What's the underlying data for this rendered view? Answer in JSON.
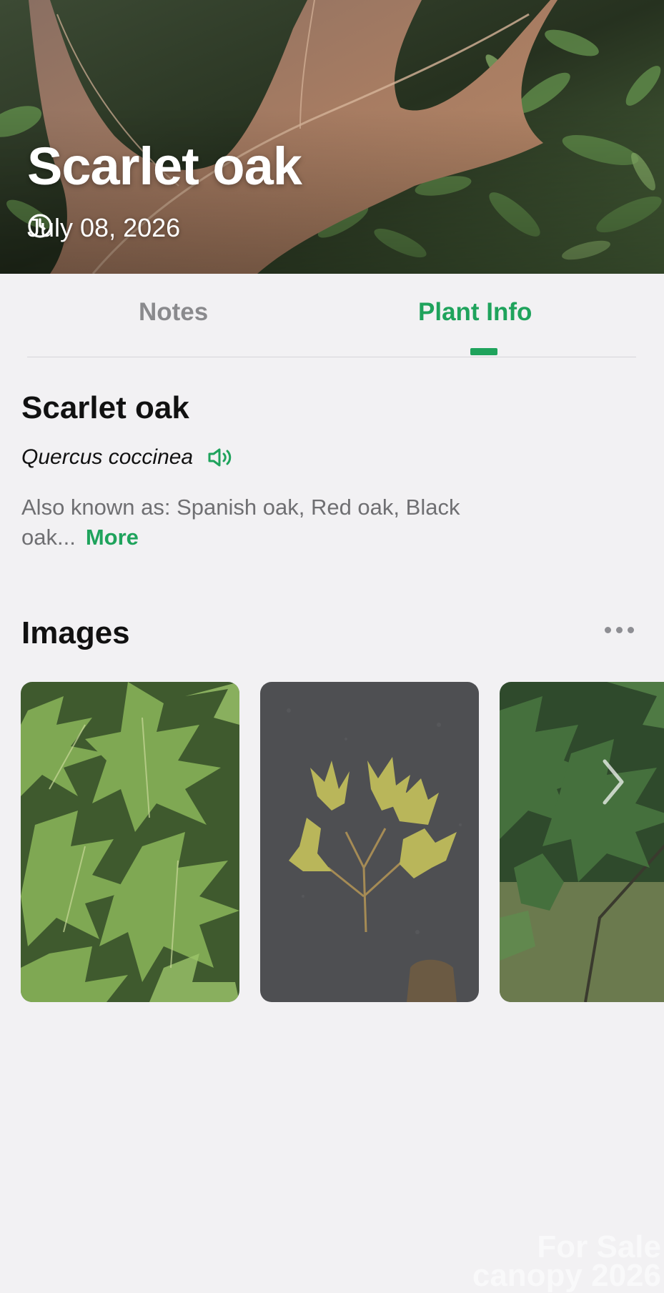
{
  "header": {
    "title": "Scarlet oak",
    "date": "July 08, 2026",
    "date_icon": "clock-icon"
  },
  "tabs": [
    {
      "label": "Notes",
      "active": false
    },
    {
      "label": "Plant Info",
      "active": true
    }
  ],
  "plant": {
    "common_name": "Scarlet oak",
    "scientific_name": "Quercus coccinea",
    "pronounce_icon": "speaker-icon",
    "also_known_as": "Also known as: Spanish oak, Red oak, Black oak...",
    "more_label": "More"
  },
  "images_section": {
    "title": "Images",
    "menu_icon": "more-dots-icon",
    "next_icon": "chevron-right-icon",
    "watermark_line1": "For Sale",
    "watermark_line2": "canopy 2026"
  },
  "colors": {
    "accent": "#1fa35c",
    "background": "#f2f1f3",
    "inactive_tab": "#8a8a8d"
  }
}
